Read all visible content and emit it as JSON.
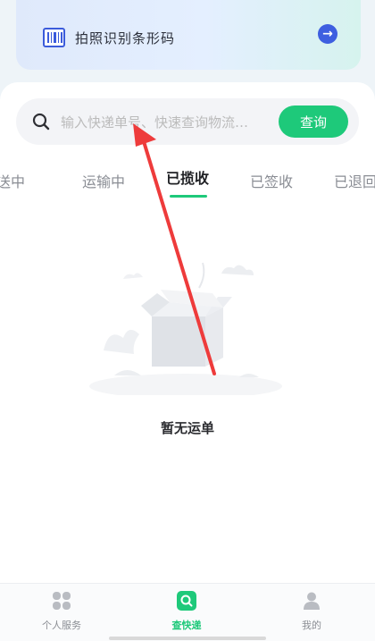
{
  "scan_card": {
    "label": "拍照识别条形码",
    "go_icon": "arrow-right-icon"
  },
  "search": {
    "placeholder": "输入快递单号、快速查询物流…",
    "button_label": "查询"
  },
  "tabs": [
    {
      "label": "派送中",
      "visible_label": "送中",
      "active": false
    },
    {
      "label": "运输中",
      "active": false
    },
    {
      "label": "已揽收",
      "active": true
    },
    {
      "label": "已签收",
      "active": false
    },
    {
      "label": "已退回",
      "visible_label": "已退回",
      "active": false
    }
  ],
  "empty_state": {
    "message": "暂无运单"
  },
  "bottom_nav": [
    {
      "label": "个人服务",
      "icon": "grid-icon",
      "active": false
    },
    {
      "label": "查快递",
      "icon": "search-box-icon",
      "active": true
    },
    {
      "label": "我的",
      "icon": "user-icon",
      "active": false
    }
  ],
  "colors": {
    "accent": "#1ec97a",
    "scan_icon": "#3b5bdb",
    "arrow": "#ee3b3b"
  }
}
